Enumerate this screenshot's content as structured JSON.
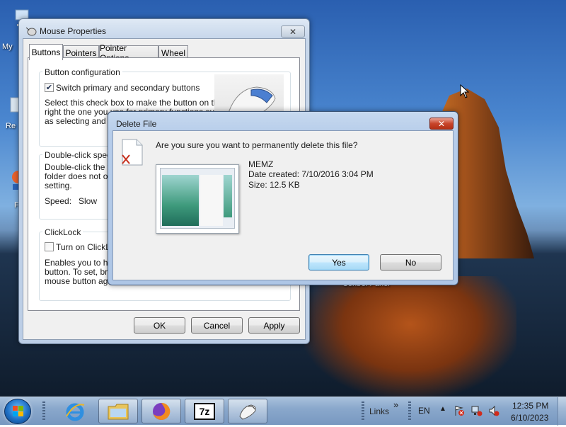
{
  "desktop": {
    "icons": [
      {
        "label": "My",
        "icon": "computer-icon"
      },
      {
        "label": "Re",
        "icon": "recycle-bin-icon"
      },
      {
        "label": "F",
        "icon": "firefox-icon"
      }
    ],
    "partial_text": "Control Panel"
  },
  "mouse_properties": {
    "title": "Mouse Properties",
    "tabs": [
      "Buttons",
      "Pointers",
      "Pointer Options",
      "Wheel"
    ],
    "selected_tab": "Buttons",
    "button_configuration": {
      "title": "Button configuration",
      "checkbox_label": "Switch primary and secondary buttons",
      "checked": true,
      "description": [
        "Select this check box to make the button on the",
        "right the one you use for primary functions such",
        "as selecting and dragging."
      ]
    },
    "double_click": {
      "title": "Double-click speed",
      "description": [
        "Double-click the folder to test your setting. If the",
        "folder does not open or close, try using a slower",
        "setting."
      ],
      "speed_label": "Speed:",
      "slow_label": "Slow"
    },
    "clicklock": {
      "title": "ClickLock",
      "checkbox_label": "Turn on ClickLock",
      "checked": false,
      "description": [
        "Enables you to highlight or drag without holding down the mouse",
        "button. To set, briefly press the mouse button. To release, click the",
        "mouse button again."
      ]
    },
    "buttons": {
      "ok": "OK",
      "cancel": "Cancel",
      "apply": "Apply"
    }
  },
  "delete_dialog": {
    "title": "Delete File",
    "question": "Are you sure you want to permanently delete this file?",
    "file_name": "MEMZ",
    "date_created": "Date created: 7/10/2016 3:04 PM",
    "size": "Size: 12.5 KB",
    "yes_label": "Yes",
    "no_label": "No"
  },
  "taskbar": {
    "pinned": [
      "internet-explorer-icon",
      "file-explorer-icon",
      "firefox-icon",
      "7zip-icon",
      "mouse-icon"
    ],
    "sevenzip_label": "7z",
    "links_label": "Links",
    "chevron": "»",
    "language": "EN",
    "time": "12:35 PM",
    "date": "6/10/2023"
  },
  "colors": {
    "accent": "#3c7fb1",
    "close_red": "#c9452b",
    "titlebar": "#c6d6ea"
  }
}
